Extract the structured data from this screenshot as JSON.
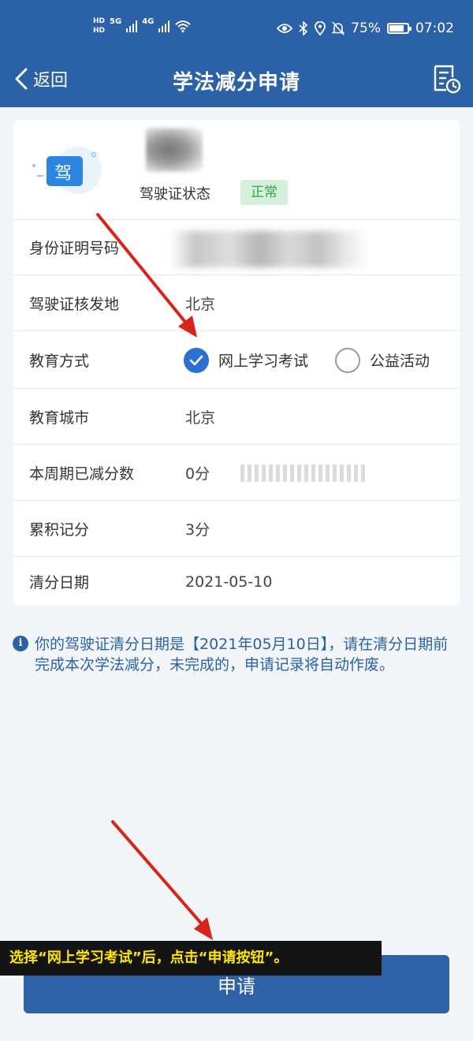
{
  "status_bar": {
    "hd_top": "HD",
    "hd_bottom": "HD",
    "net1": "5G",
    "net2": "4G",
    "battery_text": "75%",
    "battery_level": 0.75,
    "time": "07:02"
  },
  "nav": {
    "back_label": "返回",
    "title": "学法减分申请"
  },
  "license": {
    "icon_char": "驾",
    "status_label": "驾驶证状态",
    "status_value": "正常"
  },
  "rows": {
    "id_label": "身份证明号码",
    "issue_place_label": "驾驶证核发地",
    "issue_place_value": "北京",
    "edu_method_label": "教育方式",
    "edu_option_online": "网上学习考试",
    "edu_option_public": "公益活动",
    "edu_city_label": "教育城市",
    "edu_city_value": "北京",
    "period_deducted_label": "本周期已减分数",
    "period_deducted_value": "0分",
    "total_points_label": "累积记分",
    "total_points_value": "3分",
    "clear_date_label": "清分日期",
    "clear_date_value": "2021-05-10"
  },
  "notice": {
    "text": "你的驾驶证清分日期是【2021年05月10日】，请在清分日期前完成本次学法减分，未完成的，申请记录将自动作废。"
  },
  "apply_button": "申请",
  "caption": "选择“网上学习考试”后，点击“申请按钮”。",
  "colors": {
    "primary": "#2b62a7",
    "status_ok_bg": "#d5f1dc",
    "status_ok_text": "#2fa54b",
    "arrow": "#d9241b",
    "caption_text": "#ffe600"
  }
}
